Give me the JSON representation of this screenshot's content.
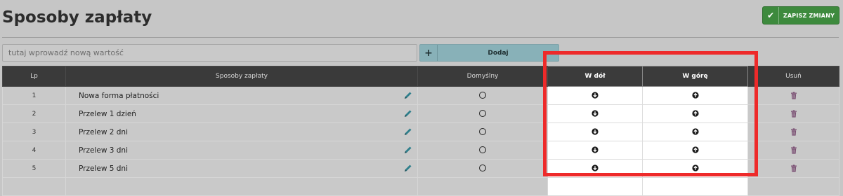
{
  "header": {
    "title": "Sposoby zapłaty",
    "save_label": "ZAPISZ ZMIANY"
  },
  "new_entry": {
    "placeholder": "tutaj wprowadź nową wartość",
    "value": "",
    "add_plus": "+",
    "add_label": "Dodaj"
  },
  "table": {
    "columns": {
      "lp": "Lp",
      "name": "Sposoby zapłaty",
      "default": "Domyślny",
      "down": "W dół",
      "up": "W górę",
      "delete": "Usuń"
    },
    "rows": [
      {
        "lp": "1",
        "name": "Nowa forma płatności"
      },
      {
        "lp": "2",
        "name": "Przelew 1 dzień"
      },
      {
        "lp": "3",
        "name": "Przelew 2 dni"
      },
      {
        "lp": "4",
        "name": "Przelew 3 dni"
      },
      {
        "lp": "5",
        "name": "Przelew 5 dni"
      }
    ]
  },
  "colors": {
    "save_button": "#3d8a3d",
    "add_button": "#88b1b8",
    "header_bg": "#3a3a3a",
    "highlight_border": "#ee2a2a",
    "edit_icon": "#2f7f8c",
    "trash_icon": "#7a4f73"
  },
  "icons": {
    "save": "check-icon",
    "add": "plus-icon",
    "edit": "pencil-icon",
    "default": "radio-circle-icon",
    "down": "arrow-down-circle-icon",
    "up": "arrow-up-circle-icon",
    "delete": "trash-icon"
  }
}
